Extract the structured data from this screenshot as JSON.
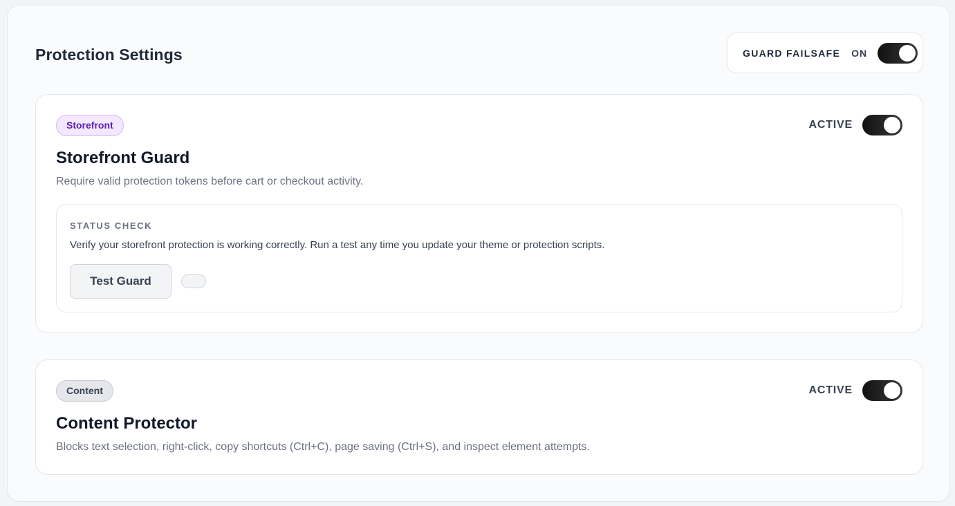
{
  "header": {
    "title": "Protection Settings",
    "failsafe_label": "GUARD FAILSAFE",
    "failsafe_state": "ON"
  },
  "cards": [
    {
      "badge": "Storefront",
      "state": "ACTIVE",
      "title": "Storefront Guard",
      "description": "Require valid protection tokens before cart or checkout activity.",
      "status_check": {
        "heading": "STATUS CHECK",
        "text": "Verify your storefront protection is working correctly. Run a test any time you update your theme or protection scripts.",
        "button_label": "Test Guard"
      }
    },
    {
      "badge": "Content",
      "state": "ACTIVE",
      "title": "Content Protector",
      "description": "Blocks text selection, right-click, copy shortcuts (Ctrl+C), page saving (Ctrl+S), and inspect element attempts."
    }
  ],
  "colors": {
    "toggle_on": "#111111",
    "storefront_badge_bg": "#f3e8ff",
    "storefront_badge_text": "#5b21b6",
    "content_badge_bg": "#e5e7eb"
  },
  "icons": {
    "toggles": "toggle-switch-icon"
  }
}
